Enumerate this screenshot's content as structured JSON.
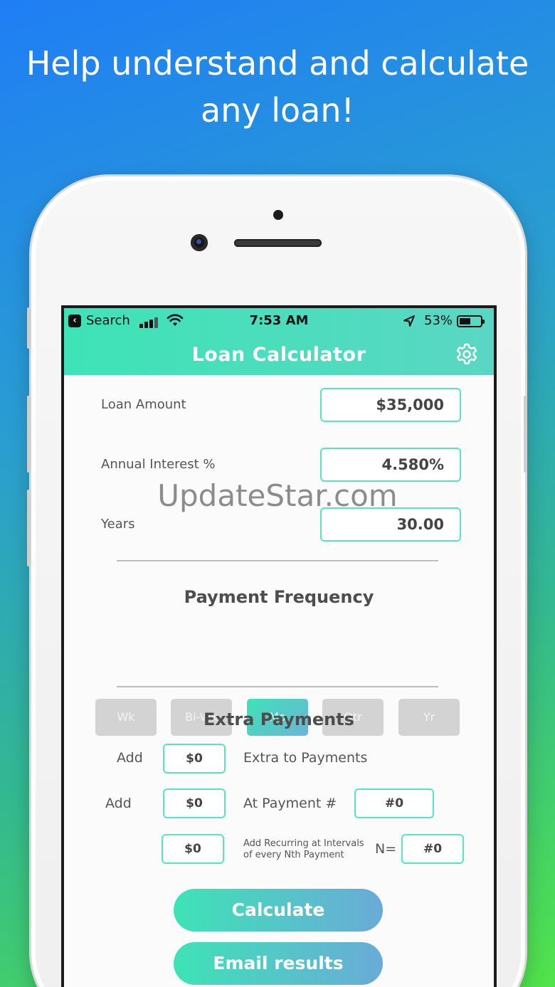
{
  "headline": [
    "Help understand and calculate",
    "any loan!"
  ],
  "status_bar": {
    "back_app": "Search",
    "time": "7:53 AM",
    "battery_percent": "53%",
    "battery_level": 0.53
  },
  "app": {
    "title": "Loan Calculator",
    "settings_icon": "gear-icon"
  },
  "fields": {
    "loan_amount": {
      "label": "Loan Amount",
      "value": "$35,000"
    },
    "interest": {
      "label": "Annual Interest %",
      "value": "4.580%"
    },
    "years": {
      "label": "Years",
      "value": "30.00"
    }
  },
  "payment_frequency": {
    "title": "Payment Frequency",
    "options": [
      "Wk",
      "Bi-Wk",
      "Mo",
      "Qtr",
      "Yr"
    ],
    "selected": "Mo"
  },
  "extra_payments": {
    "title": "Extra Payments",
    "row1": {
      "add_label": "Add",
      "amount": "$0",
      "description": "Extra to Payments"
    },
    "row2": {
      "add_label": "Add",
      "amount": "$0",
      "description": "At Payment #",
      "payment_number": "#0"
    },
    "row3": {
      "amount": "$0",
      "description_line1": "Add Recurring at Intervals",
      "description_line2": "of every Nth Payment",
      "n_label": "N=",
      "n_value": "#0"
    }
  },
  "buttons": {
    "calculate": "Calculate",
    "email": "Email results"
  },
  "watermark": "UpdateStar.com",
  "colors": {
    "accent": "#3ee3b6",
    "accent_end": "#6aaad8",
    "inactive_button": "#d3d3d3"
  }
}
